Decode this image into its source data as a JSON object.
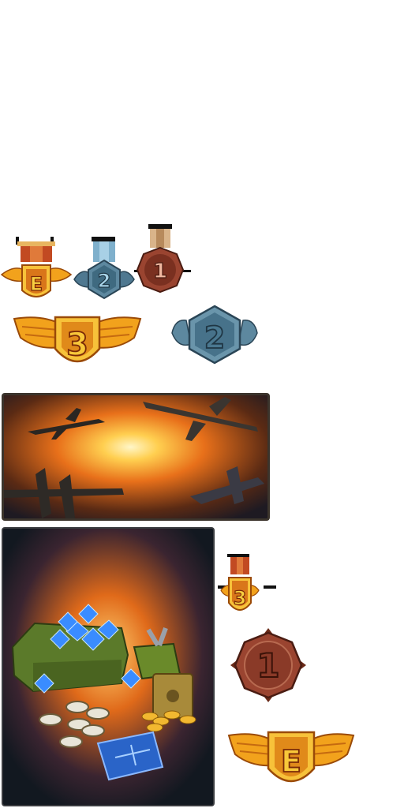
{
  "badges": {
    "medal_e_ribbon": {
      "glyph": "E",
      "tier": "gold",
      "icon": "gold-winged-medal-with-ribbon"
    },
    "medal_2_ribbon": {
      "glyph": "2",
      "tier": "silver",
      "icon": "silver-winged-hexagon-medal-with-ribbon"
    },
    "medal_1_ribbon": {
      "glyph": "1",
      "tier": "bronze",
      "icon": "bronze-octagon-medal-with-ribbon"
    },
    "badge_3_wings": {
      "glyph": "3",
      "tier": "gold",
      "icon": "gold-winged-shield-badge"
    },
    "badge_2_hex": {
      "glyph": "2",
      "tier": "silver",
      "icon": "silver-hexagon-laurel-badge"
    },
    "medal_3_ribbon": {
      "glyph": "3",
      "tier": "gold",
      "icon": "gold-shield-medal-with-ribbon"
    },
    "badge_1_octagon": {
      "glyph": "1",
      "tier": "bronze",
      "icon": "bronze-octagon-badge"
    },
    "badge_e_wings": {
      "glyph": "E",
      "tier": "gold",
      "icon": "gold-winged-shield-badge"
    }
  },
  "art": {
    "air_battle": {
      "icon": "air-battle-explosion-banner"
    },
    "reward_chest": {
      "icon": "reward-chest-gems-coins-blueprint"
    }
  },
  "colors": {
    "gold": "#f2a21c",
    "gold_dark": "#9a4a08",
    "silver": "#4f7890",
    "silver_dark": "#2a4556",
    "bronze": "#8a3a28",
    "bronze_dark": "#4a1c12",
    "ribbon_red": "#c24a22",
    "ribbon_blue": "#7fb0cc",
    "ribbon_tan": "#d9b48a"
  }
}
